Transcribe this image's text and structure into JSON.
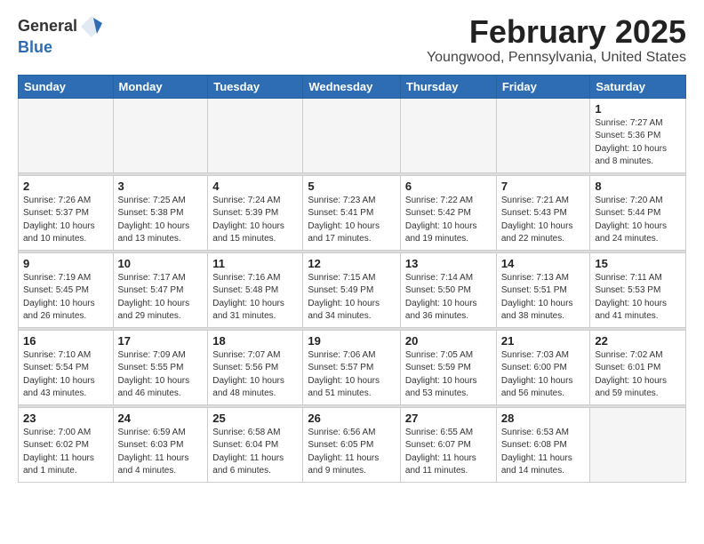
{
  "header": {
    "logo_general": "General",
    "logo_blue": "Blue",
    "title": "February 2025",
    "subtitle": "Youngwood, Pennsylvania, United States"
  },
  "calendar": {
    "days_of_week": [
      "Sunday",
      "Monday",
      "Tuesday",
      "Wednesday",
      "Thursday",
      "Friday",
      "Saturday"
    ],
    "weeks": [
      [
        {
          "num": "",
          "info": ""
        },
        {
          "num": "",
          "info": ""
        },
        {
          "num": "",
          "info": ""
        },
        {
          "num": "",
          "info": ""
        },
        {
          "num": "",
          "info": ""
        },
        {
          "num": "",
          "info": ""
        },
        {
          "num": "1",
          "info": "Sunrise: 7:27 AM\nSunset: 5:36 PM\nDaylight: 10 hours and 8 minutes."
        }
      ],
      [
        {
          "num": "2",
          "info": "Sunrise: 7:26 AM\nSunset: 5:37 PM\nDaylight: 10 hours and 10 minutes."
        },
        {
          "num": "3",
          "info": "Sunrise: 7:25 AM\nSunset: 5:38 PM\nDaylight: 10 hours and 13 minutes."
        },
        {
          "num": "4",
          "info": "Sunrise: 7:24 AM\nSunset: 5:39 PM\nDaylight: 10 hours and 15 minutes."
        },
        {
          "num": "5",
          "info": "Sunrise: 7:23 AM\nSunset: 5:41 PM\nDaylight: 10 hours and 17 minutes."
        },
        {
          "num": "6",
          "info": "Sunrise: 7:22 AM\nSunset: 5:42 PM\nDaylight: 10 hours and 19 minutes."
        },
        {
          "num": "7",
          "info": "Sunrise: 7:21 AM\nSunset: 5:43 PM\nDaylight: 10 hours and 22 minutes."
        },
        {
          "num": "8",
          "info": "Sunrise: 7:20 AM\nSunset: 5:44 PM\nDaylight: 10 hours and 24 minutes."
        }
      ],
      [
        {
          "num": "9",
          "info": "Sunrise: 7:19 AM\nSunset: 5:45 PM\nDaylight: 10 hours and 26 minutes."
        },
        {
          "num": "10",
          "info": "Sunrise: 7:17 AM\nSunset: 5:47 PM\nDaylight: 10 hours and 29 minutes."
        },
        {
          "num": "11",
          "info": "Sunrise: 7:16 AM\nSunset: 5:48 PM\nDaylight: 10 hours and 31 minutes."
        },
        {
          "num": "12",
          "info": "Sunrise: 7:15 AM\nSunset: 5:49 PM\nDaylight: 10 hours and 34 minutes."
        },
        {
          "num": "13",
          "info": "Sunrise: 7:14 AM\nSunset: 5:50 PM\nDaylight: 10 hours and 36 minutes."
        },
        {
          "num": "14",
          "info": "Sunrise: 7:13 AM\nSunset: 5:51 PM\nDaylight: 10 hours and 38 minutes."
        },
        {
          "num": "15",
          "info": "Sunrise: 7:11 AM\nSunset: 5:53 PM\nDaylight: 10 hours and 41 minutes."
        }
      ],
      [
        {
          "num": "16",
          "info": "Sunrise: 7:10 AM\nSunset: 5:54 PM\nDaylight: 10 hours and 43 minutes."
        },
        {
          "num": "17",
          "info": "Sunrise: 7:09 AM\nSunset: 5:55 PM\nDaylight: 10 hours and 46 minutes."
        },
        {
          "num": "18",
          "info": "Sunrise: 7:07 AM\nSunset: 5:56 PM\nDaylight: 10 hours and 48 minutes."
        },
        {
          "num": "19",
          "info": "Sunrise: 7:06 AM\nSunset: 5:57 PM\nDaylight: 10 hours and 51 minutes."
        },
        {
          "num": "20",
          "info": "Sunrise: 7:05 AM\nSunset: 5:59 PM\nDaylight: 10 hours and 53 minutes."
        },
        {
          "num": "21",
          "info": "Sunrise: 7:03 AM\nSunset: 6:00 PM\nDaylight: 10 hours and 56 minutes."
        },
        {
          "num": "22",
          "info": "Sunrise: 7:02 AM\nSunset: 6:01 PM\nDaylight: 10 hours and 59 minutes."
        }
      ],
      [
        {
          "num": "23",
          "info": "Sunrise: 7:00 AM\nSunset: 6:02 PM\nDaylight: 11 hours and 1 minute."
        },
        {
          "num": "24",
          "info": "Sunrise: 6:59 AM\nSunset: 6:03 PM\nDaylight: 11 hours and 4 minutes."
        },
        {
          "num": "25",
          "info": "Sunrise: 6:58 AM\nSunset: 6:04 PM\nDaylight: 11 hours and 6 minutes."
        },
        {
          "num": "26",
          "info": "Sunrise: 6:56 AM\nSunset: 6:05 PM\nDaylight: 11 hours and 9 minutes."
        },
        {
          "num": "27",
          "info": "Sunrise: 6:55 AM\nSunset: 6:07 PM\nDaylight: 11 hours and 11 minutes."
        },
        {
          "num": "28",
          "info": "Sunrise: 6:53 AM\nSunset: 6:08 PM\nDaylight: 11 hours and 14 minutes."
        },
        {
          "num": "",
          "info": ""
        }
      ]
    ]
  }
}
